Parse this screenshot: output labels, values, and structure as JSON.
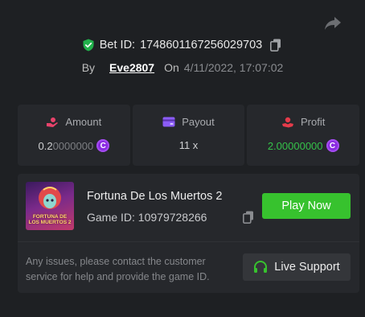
{
  "header": {
    "bet_id_label": "Bet ID:",
    "bet_id": "1748601167256029703",
    "by_label": "By",
    "username": "Eve2807",
    "on_label": "On",
    "date": "4/11/2022, 17:07:02"
  },
  "stats": {
    "amount": {
      "label": "Amount",
      "value_main": "0.2",
      "value_tail": "0000000",
      "icon": "coins-icon",
      "color": "#e8436b"
    },
    "payout": {
      "label": "Payout",
      "value": "11 x",
      "icon": "wallet-icon",
      "color": "#8b5cf6"
    },
    "profit": {
      "label": "Profit",
      "value_main": "2.",
      "value_tail": "00000000",
      "icon": "hand-coin-icon",
      "color": "#e53b4a"
    },
    "coin_symbol": "C"
  },
  "game": {
    "title": "Fortuna De Los Muertos 2",
    "id_label": "Game ID:",
    "id": "10979728266",
    "thumb_text": "FORTUNA DE LOS MUERTOS 2",
    "play_label": "Play Now"
  },
  "support": {
    "text": "Any issues, please contact the customer service for help and provide the game ID.",
    "button_label": "Live Support"
  },
  "colors": {
    "accent_green": "#37c22e",
    "profit_green": "#35c24a",
    "coin_purple": "#8a2be2"
  }
}
